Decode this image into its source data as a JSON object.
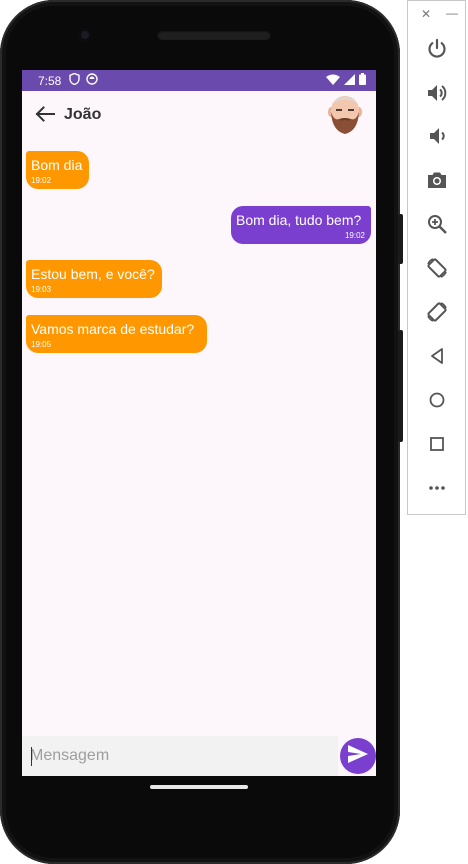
{
  "status_bar": {
    "time": "7:58"
  },
  "chat": {
    "contact_name": "João",
    "messages": [
      {
        "direction": "received",
        "text": "Bom dia",
        "time": "19:02"
      },
      {
        "direction": "sent",
        "text": "Bom dia, tudo bem?",
        "time": "19:02"
      },
      {
        "direction": "received",
        "text": "Estou bem, e você?",
        "time": "19:03"
      },
      {
        "direction": "received",
        "text": "Vamos marca de estudar?",
        "time": "19:05"
      }
    ]
  },
  "composer": {
    "value": "",
    "placeholder": "Mensagem"
  },
  "colors": {
    "status_bar": "#6a4aad",
    "received_bubble": "#ff9800",
    "sent_bubble": "#7b3fcf",
    "send_button": "#7b3fcf",
    "chat_background": "#fdf7fc"
  },
  "emulator_toolbar": {
    "buttons": [
      "power-icon",
      "volume-up-icon",
      "volume-down-icon",
      "camera-icon",
      "zoom-icon",
      "rotate-left-icon",
      "rotate-right-icon",
      "back-icon",
      "home-icon",
      "overview-icon",
      "more-icon"
    ]
  }
}
